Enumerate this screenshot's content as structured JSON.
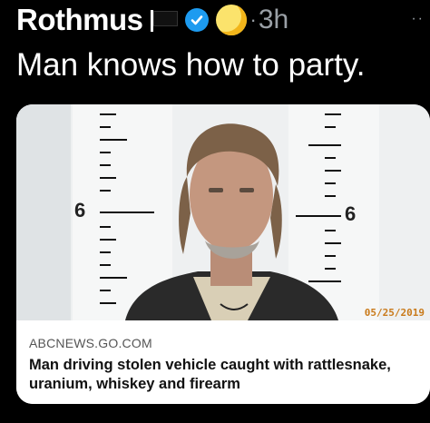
{
  "tweet": {
    "author": "Rothmus",
    "separator": "·",
    "time": "3h",
    "more": "··",
    "text": "Man knows how to party.",
    "icons": [
      "flag-icon",
      "verified-badge-icon",
      "moon-emoji-icon",
      "more-options-icon"
    ]
  },
  "card": {
    "domain": "ABCNEWS.GO.COM",
    "headline": "Man driving stolen vehicle caught with rattlesnake, uranium, whiskey and firearm",
    "photo": {
      "height_marker_left": "6",
      "height_marker_right": "6",
      "date_stamp": "05/25/2019"
    }
  },
  "colors": {
    "background": "#000000",
    "verified": "#1d9bf0",
    "muted_text": "#9aa0a6",
    "card_background": "#ffffff"
  }
}
